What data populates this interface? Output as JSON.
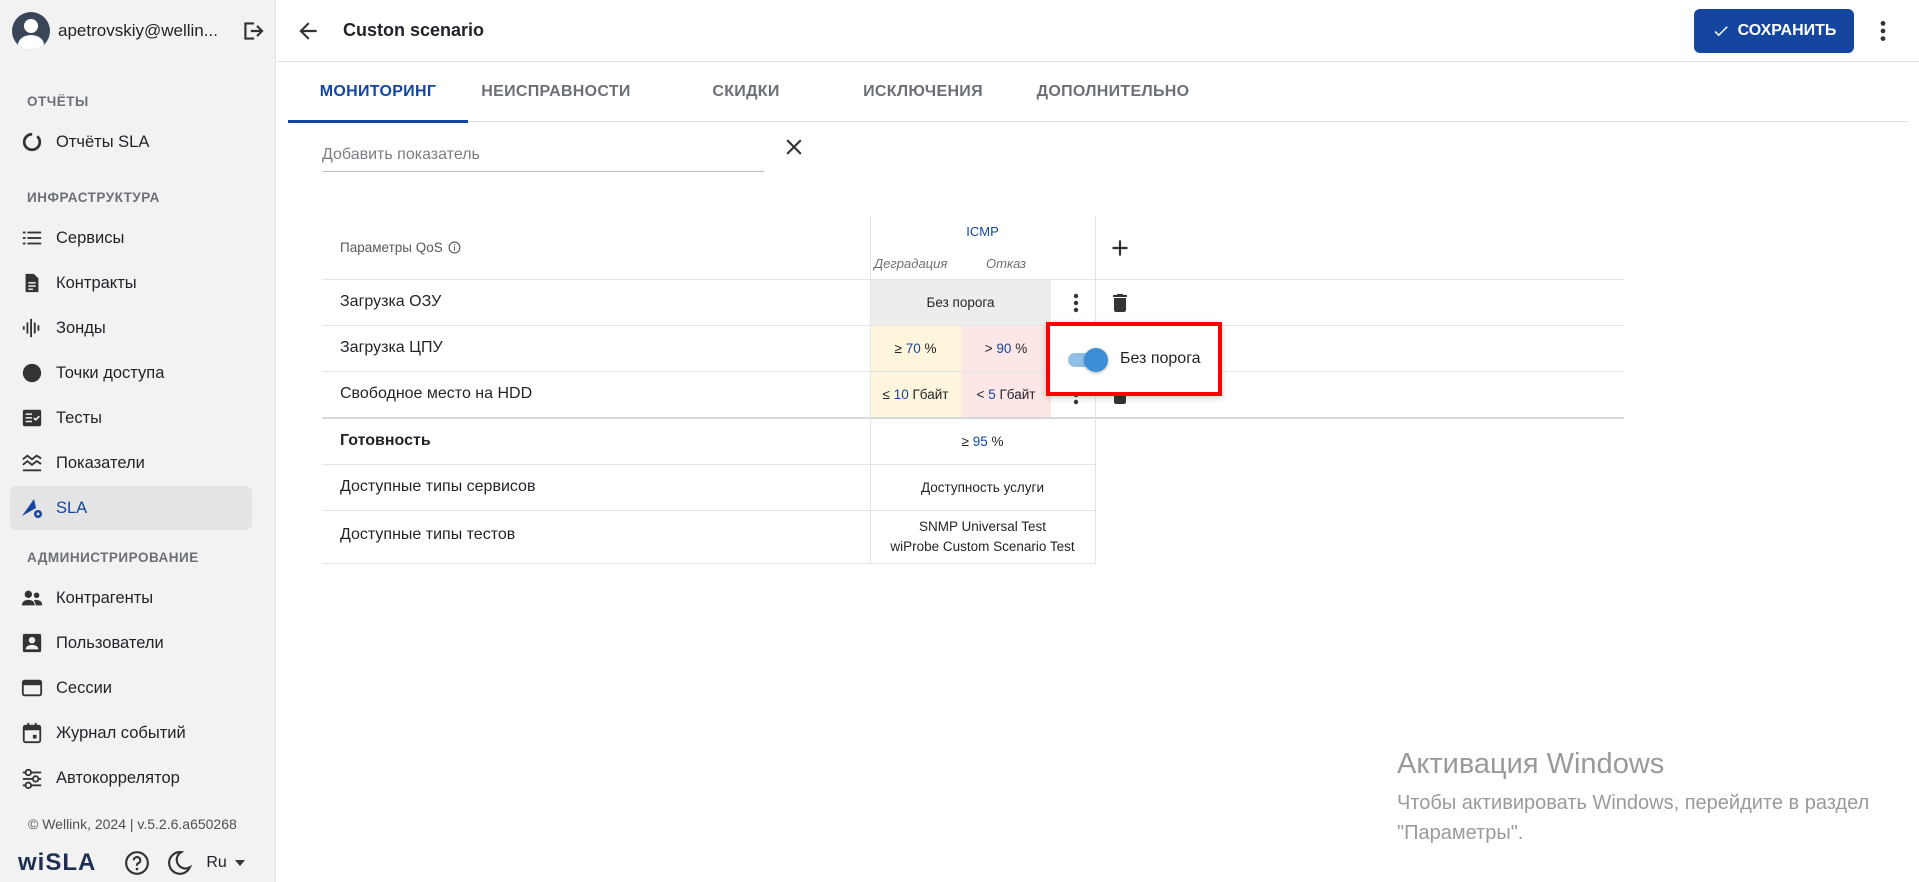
{
  "user": {
    "email": "apetrovskiy@wellin..."
  },
  "sidebar": {
    "sections": {
      "reports": "ОТЧЁТЫ",
      "infrastructure": "ИНФРАСТРУКТУРА",
      "administration": "АДМИНИСТРИРОВАНИЕ"
    },
    "items": {
      "sla_reports": "Отчёты SLA",
      "services": "Сервисы",
      "contracts": "Контракты",
      "probes": "Зонды",
      "access_points": "Точки доступа",
      "tests": "Тесты",
      "metrics": "Показатели",
      "sla": "SLA",
      "counterparties": "Контрагенты",
      "users": "Пользователи",
      "sessions": "Сессии",
      "event_log": "Журнал событий",
      "autocorrelator": "Автокоррелятор"
    },
    "footer": "© Wellink, 2024 | v.5.2.6.a650268",
    "logo": "wiSLA",
    "language": "Ru"
  },
  "header": {
    "title": "Custon scenario",
    "save_label": "СОХРАНИТЬ"
  },
  "tabs": {
    "monitoring": "МОНИТОРИНГ",
    "faults": "НЕИСПРАВНОСТИ",
    "discounts": "СКИДКИ",
    "exceptions": "ИСКЛЮЧЕНИЯ",
    "additional": "ДОПОЛНИТЕЛЬНО"
  },
  "add_metric": {
    "placeholder": "Добавить показатель"
  },
  "table": {
    "header_label": "Параметры QoS",
    "group": "ICMP",
    "degradation": "Деградация",
    "failure": "Отказ",
    "rows": {
      "ram": {
        "name": "Загрузка ОЗУ",
        "value": "Без порога"
      },
      "cpu": {
        "name": "Загрузка ЦПУ",
        "deg_op": "≥",
        "deg_num": "70",
        "deg_unit": "%",
        "fail_op": ">",
        "fail_num": "90",
        "fail_unit": "%"
      },
      "hdd": {
        "name": "Свободное место на HDD",
        "deg_op": "≤",
        "deg_num": "10",
        "deg_unit": "Гбайт",
        "fail_op": "<",
        "fail_num": "5",
        "fail_unit": "Гбайт"
      },
      "readiness": {
        "name": "Готовность",
        "op": "≥",
        "num": "95",
        "unit": "%"
      },
      "service_types": {
        "name": "Доступные типы сервисов",
        "value": "Доступность услуги"
      },
      "test_types": {
        "name": "Доступные типы тестов",
        "value1": "SNMP Universal Test",
        "value2": "wiProbe Custom Scenario Test"
      }
    }
  },
  "popup": {
    "label": "Без порога",
    "toggle_on": true
  },
  "colors": {
    "accent": "#1446a0",
    "degradation_bg": "#fdf5dc",
    "failure_bg": "#fde6e6",
    "highlight_border": "#ff0000"
  },
  "watermark": {
    "title": "Активация Windows",
    "text": "Чтобы активировать Windows, перейдите в раздел \"Параметры\"."
  }
}
